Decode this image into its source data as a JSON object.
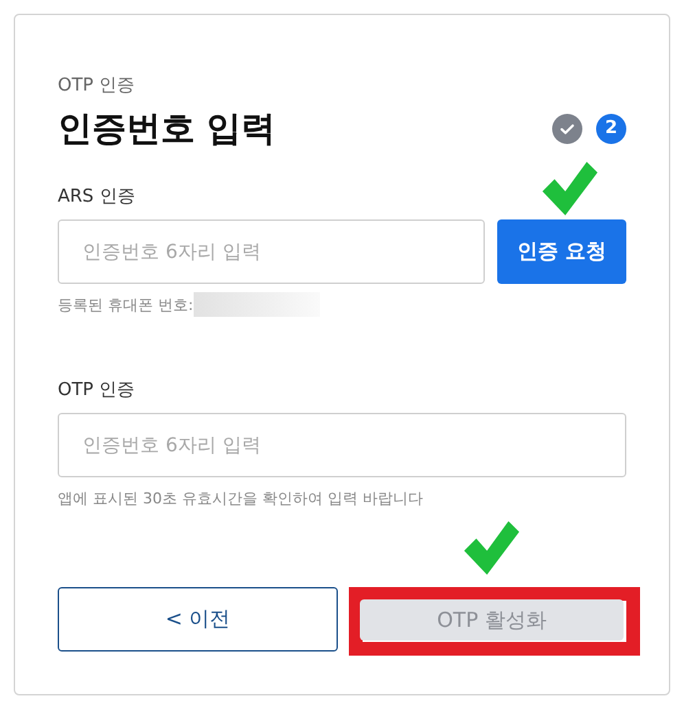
{
  "eyebrow": "OTP 인증",
  "title": "인증번호 입력",
  "steps": [
    {
      "done": true
    },
    {
      "done": false,
      "label": "2"
    }
  ],
  "ars": {
    "label": "ARS 인증",
    "placeholder": "인증번호 6자리 입력",
    "button": {
      "label": "인증 요청",
      "marked": true
    },
    "helper": "등록된 휴대폰 번호:",
    "redacted": true
  },
  "otp": {
    "label": "OTP 인증",
    "placeholder": "인증번호 6자리 입력",
    "helper": "앱에 표시된 30초 유효시간을 확인하여 입력 바랍니다"
  },
  "buttons": [
    {
      "kind": "back",
      "label": "< 이전",
      "disabled": false,
      "marked": false,
      "highlighted": false
    },
    {
      "kind": "primary",
      "label": "OTP 활성화",
      "disabled": true,
      "marked": true,
      "highlighted": true
    }
  ]
}
